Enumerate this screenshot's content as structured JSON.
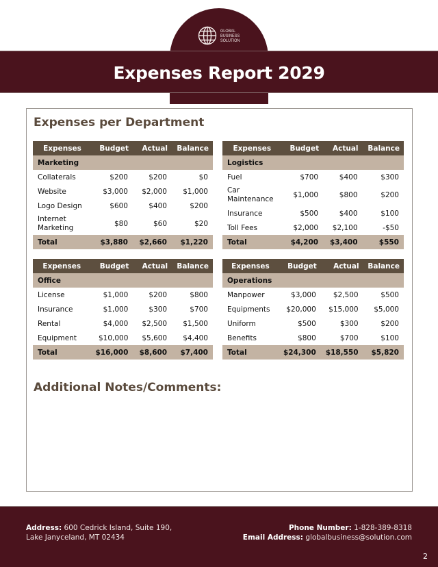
{
  "logo": {
    "icon": "globe-icon",
    "lines": [
      "GLOBAL",
      "BUSINESS",
      "SOLUTION"
    ]
  },
  "header": {
    "title": "Expenses Report 2029"
  },
  "section_title": "Expenses per Department",
  "columns": [
    "Expenses",
    "Budget",
    "Actual",
    "Balance"
  ],
  "departments": [
    {
      "name": "Marketing",
      "items": [
        {
          "label": "Collaterals",
          "budget": "$200",
          "actual": "$200",
          "balance": "$0"
        },
        {
          "label": "Website",
          "budget": "$3,000",
          "actual": "$2,000",
          "balance": "$1,000"
        },
        {
          "label": "Logo Design",
          "budget": "$600",
          "actual": "$400",
          "balance": "$200"
        },
        {
          "label": "Internet Marketing",
          "budget": "$80",
          "actual": "$60",
          "balance": "$20"
        }
      ],
      "total": {
        "label": "Total",
        "budget": "$3,880",
        "actual": "$2,660",
        "balance": "$1,220"
      }
    },
    {
      "name": "Logistics",
      "items": [
        {
          "label": "Fuel",
          "budget": "$700",
          "actual": "$400",
          "balance": "$300"
        },
        {
          "label": "Car Maintenance",
          "budget": "$1,000",
          "actual": "$800",
          "balance": "$200"
        },
        {
          "label": "Insurance",
          "budget": "$500",
          "actual": "$400",
          "balance": "$100"
        },
        {
          "label": "Toll Fees",
          "budget": "$2,000",
          "actual": "$2,100",
          "balance": "-$50"
        }
      ],
      "total": {
        "label": "Total",
        "budget": "$4,200",
        "actual": "$3,400",
        "balance": "$550"
      }
    },
    {
      "name": "Office",
      "items": [
        {
          "label": "License",
          "budget": "$1,000",
          "actual": "$200",
          "balance": "$800"
        },
        {
          "label": "Insurance",
          "budget": "$1,000",
          "actual": "$300",
          "balance": "$700"
        },
        {
          "label": "Rental",
          "budget": "$4,000",
          "actual": "$2,500",
          "balance": "$1,500"
        },
        {
          "label": "Equipment",
          "budget": "$10,000",
          "actual": "$5,600",
          "balance": "$4,400"
        }
      ],
      "total": {
        "label": "Total",
        "budget": "$16,000",
        "actual": "$8,600",
        "balance": "$7,400"
      }
    },
    {
      "name": "Operations",
      "items": [
        {
          "label": "Manpower",
          "budget": "$3,000",
          "actual": "$2,500",
          "balance": "$500"
        },
        {
          "label": "Equipments",
          "budget": "$20,000",
          "actual": "$15,000",
          "balance": "$5,000"
        },
        {
          "label": "Uniform",
          "budget": "$500",
          "actual": "$300",
          "balance": "$200"
        },
        {
          "label": "Benefits",
          "budget": "$800",
          "actual": "$700",
          "balance": "$100"
        }
      ],
      "total": {
        "label": "Total",
        "budget": "$24,300",
        "actual": "$18,550",
        "balance": "$5,820"
      }
    }
  ],
  "notes_title": "Additional Notes/Comments:",
  "footer": {
    "address_label": "Address:",
    "address_line1": "600 Cedrick Island, Suite 190,",
    "address_line2": "Lake Janyceland, MT 02434",
    "phone_label": "Phone Number:",
    "phone": "1-828-389-8318",
    "email_label": "Email Address:",
    "email": "globalbusiness@solution.com",
    "page_number": "2"
  },
  "colors": {
    "brand_maroon": "#4a131d",
    "header_brown": "#5d4f3f",
    "row_tan": "#c3b3a3",
    "heading_brown": "#5a4a3c"
  }
}
